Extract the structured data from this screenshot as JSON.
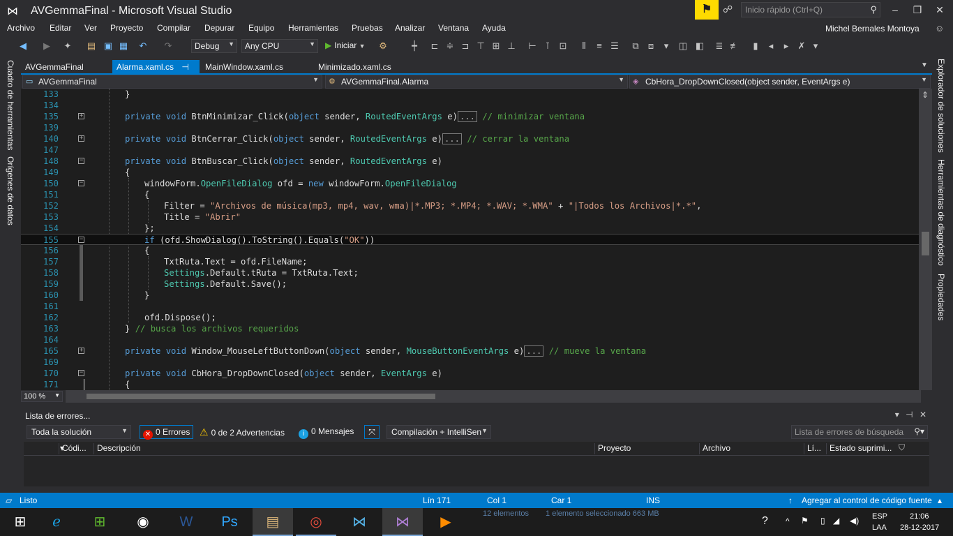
{
  "window": {
    "title": "AVGemmaFinal - Microsoft Visual Studio",
    "quick_launch_placeholder": "Inicio rápido (Ctrl+Q)",
    "minimize": "‒",
    "restore": "❐",
    "close": "✕"
  },
  "menu": [
    "Archivo",
    "Editar",
    "Ver",
    "Proyecto",
    "Compilar",
    "Depurar",
    "Equipo",
    "Herramientas",
    "Pruebas",
    "Analizar",
    "Ventana",
    "Ayuda"
  ],
  "user": {
    "name": "Michel Bernales Montoya"
  },
  "toolbar": {
    "config": "Debug",
    "platform": "Any CPU",
    "start_label": "Iniciar"
  },
  "left_rail": [
    "Cuadro de herramientas",
    "Orígenes de datos"
  ],
  "right_rail": [
    "Explorador de soluciones",
    "Herramientas de diagnóstico",
    "Propiedades"
  ],
  "tabs": [
    {
      "label": "AVGemmaFinal",
      "active": false
    },
    {
      "label": "Alarma.xaml.cs",
      "active": true,
      "pin": "⊣ ✕"
    },
    {
      "label": "MainWindow.xaml.cs",
      "active": false
    },
    {
      "label": "Minimizado.xaml.cs",
      "active": false
    }
  ],
  "nav": {
    "project": "AVGemmaFinal",
    "class": "AVGemmaFinal.Alarma",
    "member": "CbHora_DropDownClosed(object sender, EventArgs e)"
  },
  "code_lines": [
    {
      "n": "133",
      "text": "}"
    },
    {
      "n": "134",
      "text": ""
    },
    {
      "n": "135",
      "text": "private void BtnMinimizar_Click(object sender, RoutedEventArgs e)... // minimizar ventana"
    },
    {
      "n": "139",
      "text": ""
    },
    {
      "n": "140",
      "text": "private void BtnCerrar_Click(object sender, RoutedEventArgs e)... // cerrar la ventana"
    },
    {
      "n": "147",
      "text": ""
    },
    {
      "n": "148",
      "text": "private void BtnBuscar_Click(object sender, RoutedEventArgs e)"
    },
    {
      "n": "149",
      "text": "{"
    },
    {
      "n": "150",
      "text": "windowForm.OpenFileDialog ofd = new windowForm.OpenFileDialog"
    },
    {
      "n": "151",
      "text": "{"
    },
    {
      "n": "152",
      "text": "Filter = \"Archivos de música(mp3, mp4, wav, wma)|*.MP3; *.MP4; *.WAV; *.WMA\" + \"|Todos los Archivos|*.*\","
    },
    {
      "n": "153",
      "text": "Title = \"Abrir\""
    },
    {
      "n": "154",
      "text": "};"
    },
    {
      "n": "155",
      "text": "if (ofd.ShowDialog().ToString().Equals(\"OK\"))"
    },
    {
      "n": "156",
      "text": "{"
    },
    {
      "n": "157",
      "text": "TxtRuta.Text = ofd.FileName;"
    },
    {
      "n": "158",
      "text": "Settings.Default.tRuta = TxtRuta.Text;"
    },
    {
      "n": "159",
      "text": "Settings.Default.Save();"
    },
    {
      "n": "160",
      "text": "}"
    },
    {
      "n": "161",
      "text": ""
    },
    {
      "n": "162",
      "text": "ofd.Dispose();"
    },
    {
      "n": "163",
      "text": "} // busca los archivos requeridos"
    },
    {
      "n": "164",
      "text": ""
    },
    {
      "n": "165",
      "text": "private void Window_MouseLeftButtonDown(object sender, MouseButtonEventArgs e)... // mueve la ventana"
    },
    {
      "n": "169",
      "text": ""
    },
    {
      "n": "170",
      "text": "private void CbHora_DropDownClosed(object sender, EventArgs e)"
    },
    {
      "n": "171",
      "text": "{"
    }
  ],
  "zoom": "100 %",
  "error_list": {
    "title": "Lista de errores...",
    "scope": "Toda la solución",
    "errors": "0 Errores",
    "warnings": "0 de 2 Advertencias",
    "messages": "0 Mensajes",
    "build_filter": "Compilación + IntelliSen",
    "search_placeholder": "Lista de errores de búsqueda",
    "columns": [
      "Códi...",
      "Descripción",
      "Proyecto",
      "Archivo",
      "Lí...",
      "Estado suprimi..."
    ]
  },
  "status": {
    "ready": "Listo",
    "line": "Lín 171",
    "col": "Col 1",
    "char": "Car 1",
    "mode": "INS",
    "source_control": "Agregar al control de código fuente"
  },
  "taskbar": {
    "explorer_items": "12 elementos",
    "explorer_selected": "1 elemento seleccionado  663 MB",
    "lang": "ESP",
    "layout": "LAA",
    "time": "21:06",
    "date": "28-12-2017"
  }
}
